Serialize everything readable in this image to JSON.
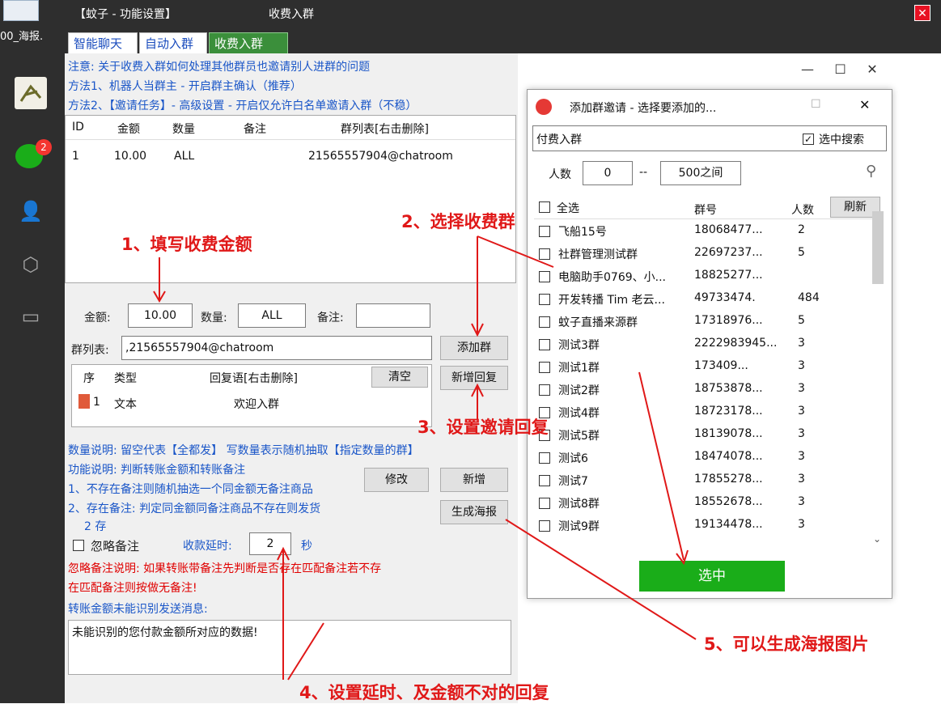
{
  "sidebar": {
    "file_label": "00_海报.",
    "badge": "2"
  },
  "titlebar": {
    "app_title": "【蚊子 - 功能设置】",
    "window_title": "收费入群"
  },
  "tabs": [
    "智能聊天",
    "自动入群",
    "收费入群"
  ],
  "notes": {
    "line1": "注意: 关于收费入群如何处理其他群员也邀请别人进群的问题",
    "line2": "方法1、机器人当群主 - 开启群主确认（推荐）",
    "line3": "方法2、【邀请任务】- 高级设置 - 开启仅允许白名单邀请入群（不稳）"
  },
  "fee_table": {
    "headers": [
      "ID",
      "金额",
      "数量",
      "备注",
      "群列表[右击删除]"
    ],
    "row": {
      "id": "1",
      "amount": "10.00",
      "count": "ALL",
      "remark": "",
      "groups": "21565557904@chatroom"
    }
  },
  "form": {
    "amount_label": "金额:",
    "amount_value": "10.00",
    "count_label": "数量:",
    "count_value": "ALL",
    "remark_label": "备注:",
    "remark_value": "",
    "groups_label": "群列表:",
    "groups_value": ",21565557904@chatroom",
    "add_group_btn": "添加群"
  },
  "reply_table": {
    "headers": [
      "序",
      "类型",
      "回复语[右击删除]"
    ],
    "clear_btn": "清空",
    "new_reply_btn": "新增回复",
    "row": {
      "index": "1",
      "type": "文本",
      "text": "欢迎入群"
    }
  },
  "explain": {
    "count_note": "数量说明: 留空代表【全都发】 写数量表示随机抽取【指定数量的群】",
    "func_note": "功能说明: 判断转账金额和转账备注",
    "item1": "1、不存在备注则随机抽选一个同金额无备注商品",
    "item2": "2、存在备注: 判定同金额同备注商品不存在则发货",
    "item3": "2 存"
  },
  "buttons": {
    "modify": "修改",
    "add": "新增",
    "poster": "生成海报"
  },
  "options": {
    "ignore_label": "忽略备注",
    "delay_label": "收款延时:",
    "delay_value": "2",
    "delay_unit": "秒",
    "ignore_note1": "忽略备注说明: 如果转账带备注先判断是否存在匹配备注若不存",
    "ignore_note2": "在匹配备注则按做无备注!",
    "unrecognized_label": "转账金额未能识别发送消息:",
    "unrecognized_text": "未能识别的您付款金额所对应的数据!"
  },
  "dialog": {
    "title": "添加群邀请 - 选择要添加的...",
    "search_text": "付费入群",
    "search_checkbox": "选中搜索",
    "people_label": "人数",
    "min": "0",
    "range_sep": "--",
    "max": "500之间",
    "headers": {
      "all": "全选",
      "id": "群号",
      "count": "人数",
      "refresh": "刷新"
    },
    "rows": [
      {
        "name": "飞船15号",
        "id": "18068477...",
        "count": "2"
      },
      {
        "name": "社群管理测试群",
        "id": "22697237...",
        "count": "5"
      },
      {
        "name": "电脑助手0769、小...",
        "id": "18825277...",
        "count": ""
      },
      {
        "name": "开发转播 Tim 老云...",
        "id": "49733474.",
        "count": "484"
      },
      {
        "name": "蚊子直播来源群",
        "id": "17318976...",
        "count": "5"
      },
      {
        "name": "测试3群",
        "id": "2222983945...",
        "count": "3"
      },
      {
        "name": "测试1群",
        "id": "173409...",
        "count": "3"
      },
      {
        "name": "测试2群",
        "id": "18753878...",
        "count": "3"
      },
      {
        "name": "测试4群",
        "id": "18723178...",
        "count": "3"
      },
      {
        "name": "测试5群",
        "id": "18139078...",
        "count": "3"
      },
      {
        "name": "测试6",
        "id": "18474078...",
        "count": "3"
      },
      {
        "name": "测试7",
        "id": "17855278...",
        "count": "3"
      },
      {
        "name": "测试8群",
        "id": "18552678...",
        "count": "3"
      },
      {
        "name": "测试9群",
        "id": "19134478...",
        "count": "3"
      }
    ],
    "select_btn": "选中"
  },
  "annotations": {
    "a1": "1、填写收费金额",
    "a2": "2、选择收费群",
    "a3": "3、设置邀请回复",
    "a4": "4、设置延时、及金额不对的回复",
    "a5": "5、可以生成海报图片"
  },
  "colors": {
    "sidebar": "#2e2e2e",
    "annotation": "#e01818",
    "note_blue": "#1a56c8",
    "select_green": "#1aad19"
  }
}
